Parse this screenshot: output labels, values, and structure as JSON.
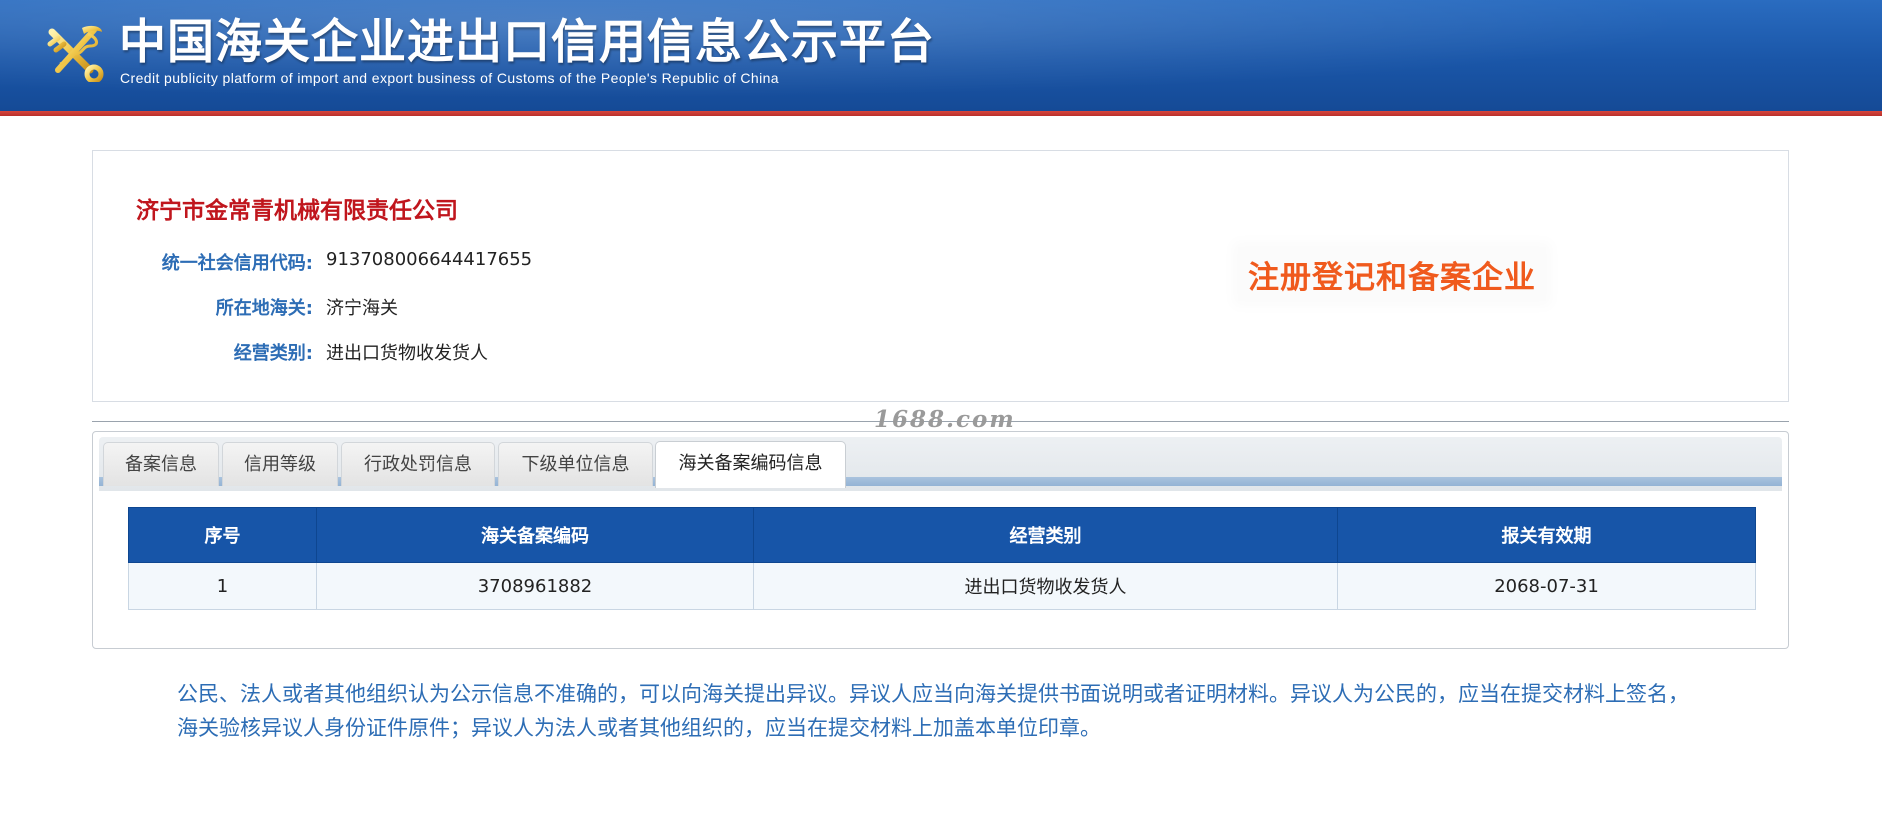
{
  "header": {
    "title": "中国海关企业进出口信用信息公示平台",
    "subtitle": "Credit publicity platform of import and export business of Customs of the People's Republic of China",
    "emblem_icon": "customs-emblem-icon"
  },
  "company": {
    "name": "济宁市金常青机械有限责任公司",
    "fields": [
      {
        "label": "统一社会信用代码:",
        "value": "913708006644417655"
      },
      {
        "label": "所在地海关:",
        "value": "济宁海关"
      },
      {
        "label": "经营类别:",
        "value": "进出口货物收发货人"
      }
    ],
    "badge": "注册登记和备案企业"
  },
  "watermark": "1688.com",
  "tabs": [
    {
      "label": "备案信息",
      "active": false
    },
    {
      "label": "信用等级",
      "active": false
    },
    {
      "label": "行政处罚信息",
      "active": false
    },
    {
      "label": "下级单位信息",
      "active": false
    },
    {
      "label": "海关备案编码信息",
      "active": true
    }
  ],
  "table": {
    "headers": [
      "序号",
      "海关备案编码",
      "经营类别",
      "报关有效期"
    ],
    "rows": [
      [
        "1",
        "3708961882",
        "进出口货物收发货人",
        "2068-07-31"
      ]
    ]
  },
  "notice": "公民、法人或者其他组织认为公示信息不准确的，可以向海关提出异议。异议人应当向海关提供书面说明或者证明材料。异议人为公民的，应当在提交材料上签名，海关验核异议人身份证件原件；异议人为法人或者其他组织的，应当在提交材料上加盖本单位印章。",
  "colors": {
    "header_blue": "#1a56a8",
    "accent_red": "#c0161d",
    "label_blue": "#2d6db5",
    "badge_orange": "#f05a1d",
    "table_header": "#1755a8"
  }
}
